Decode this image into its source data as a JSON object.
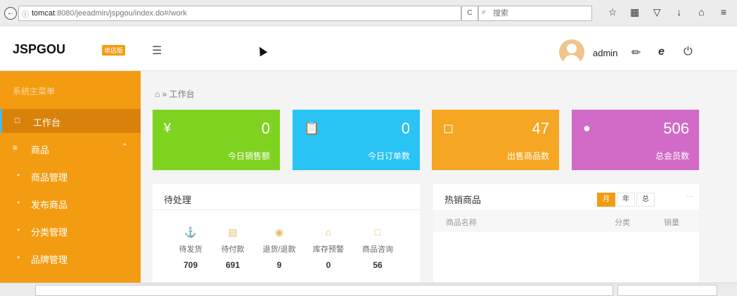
{
  "browser": {
    "url_host": "tomcat",
    "url_rest": ":8080/jeeadmin/jspgou/index.do#/work",
    "search_placeholder": "搜索",
    "info_glyph": "ⓘ",
    "back_glyph": "←",
    "reload_glyph": "C",
    "toolbar_icons": [
      "star-icon",
      "bookmark-list-icon",
      "pocket-icon",
      "download-icon",
      "home-icon",
      "menu-icon"
    ]
  },
  "header": {
    "logo": "JSPGOU",
    "logo_badge": "单店版",
    "username": "admin"
  },
  "sidebar": {
    "title": "系统主菜单",
    "items": [
      {
        "label": "工作台",
        "active": true
      },
      {
        "label": "商品",
        "expanded": true
      }
    ],
    "sub_items": [
      "商品管理",
      "发布商品",
      "分类管理",
      "品牌管理"
    ]
  },
  "breadcrumb": {
    "home_glyph": "⌂",
    "separator": "»",
    "current": "工作台"
  },
  "stats": [
    {
      "value": "0",
      "label": "今日销售额",
      "color": "#7ed321",
      "icon": "yen-icon"
    },
    {
      "value": "0",
      "label": "今日订单数",
      "color": "#29c3f4",
      "icon": "clipboard-icon"
    },
    {
      "value": "47",
      "label": "出售商品数",
      "color": "#f5a623",
      "icon": "shopping-bag-icon"
    },
    {
      "value": "506",
      "label": "总会员数",
      "color": "#d16bc7",
      "icon": "user-icon"
    }
  ],
  "pending": {
    "title": "待处理",
    "items": [
      {
        "label": "待发货",
        "value": "709"
      },
      {
        "label": "待付款",
        "value": "691"
      },
      {
        "label": "退货/退款",
        "value": "9"
      },
      {
        "label": "库存预警",
        "value": "0"
      },
      {
        "label": "商品咨询",
        "value": "56"
      }
    ]
  },
  "hot": {
    "title": "热销商品",
    "tabs": [
      "月",
      "年",
      "总"
    ],
    "active_tab": "月",
    "more": "···",
    "columns": [
      "商品名称",
      "分类",
      "销量"
    ]
  }
}
